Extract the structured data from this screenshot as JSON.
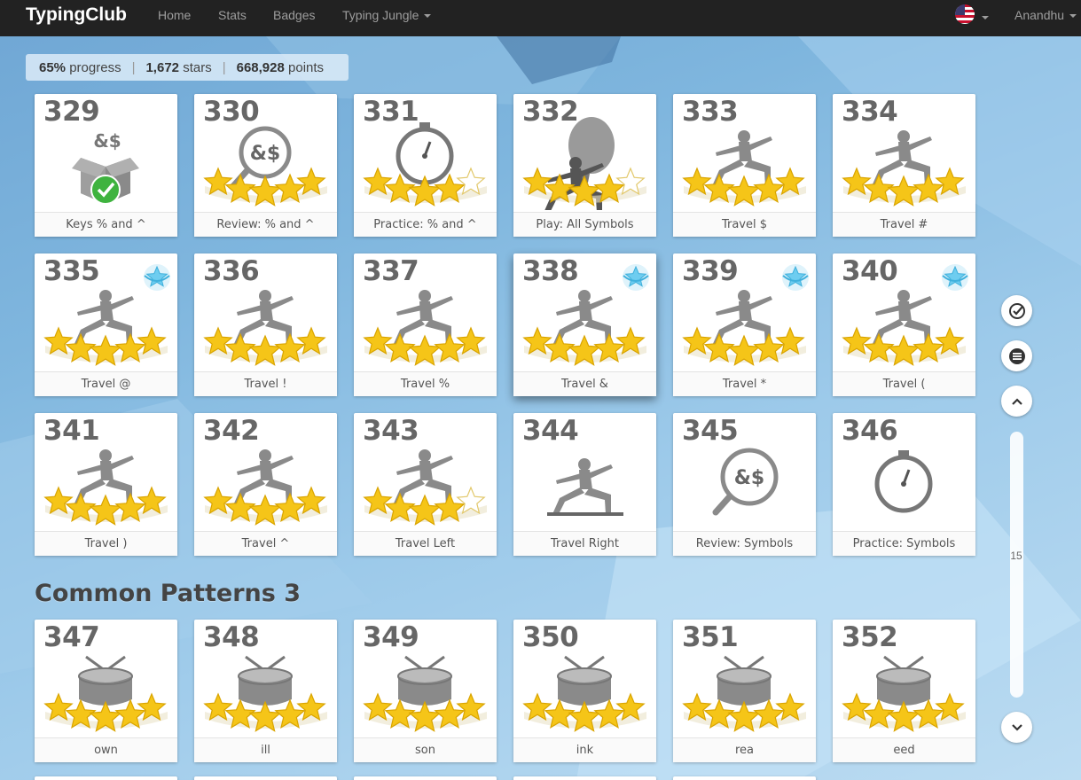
{
  "nav": {
    "brand": "TypingClub",
    "home": "Home",
    "stats": "Stats",
    "badges": "Badges",
    "jungle": "Typing Jungle",
    "user": "Anandhu"
  },
  "stats": {
    "progress_value": "65%",
    "progress_label": "progress",
    "stars_value": "1,672",
    "stars_label": "stars",
    "points_value": "668,928",
    "points_label": "points",
    "separator": "|"
  },
  "section": {
    "title": "Common Patterns 3"
  },
  "scroll": {
    "number": "15"
  },
  "colors": {
    "star": "#f5c518",
    "star_edge": "#d9a400",
    "figure": "#8a8a8a",
    "badge": "#6ecdf0",
    "check": "#3fb33f"
  },
  "lessons": [
    {
      "num": "329",
      "label": "Keys % and ^",
      "art": "box-check-icon",
      "stars": 0,
      "badge": false
    },
    {
      "num": "330",
      "label": "Review: % and ^",
      "art": "magnifier-icon",
      "stars": 5,
      "badge": false
    },
    {
      "num": "331",
      "label": "Practice: % and ^",
      "art": "stopwatch-icon",
      "stars": 4,
      "badge": false
    },
    {
      "num": "332",
      "label": "Play: All Symbols",
      "art": "balloon-icon",
      "stars": 4,
      "badge": false
    },
    {
      "num": "333",
      "label": "Travel $",
      "art": "lunge-figure-icon",
      "stars": 5,
      "badge": false
    },
    {
      "num": "334",
      "label": "Travel #",
      "art": "lunge-figure-icon",
      "stars": 5,
      "badge": false
    },
    {
      "num": "335",
      "label": "Travel @",
      "art": "lunge-figure-icon",
      "stars": 5,
      "badge": true
    },
    {
      "num": "336",
      "label": "Travel !",
      "art": "lunge-figure-icon",
      "stars": 5,
      "badge": false
    },
    {
      "num": "337",
      "label": "Travel %",
      "art": "lunge-figure-icon",
      "stars": 5,
      "badge": false
    },
    {
      "num": "338",
      "label": "Travel &",
      "art": "lunge-figure-icon",
      "stars": 5,
      "badge": true
    },
    {
      "num": "339",
      "label": "Travel *",
      "art": "lunge-figure-icon",
      "stars": 5,
      "badge": true
    },
    {
      "num": "340",
      "label": "Travel (",
      "art": "lunge-figure-icon",
      "stars": 5,
      "badge": true
    },
    {
      "num": "341",
      "label": "Travel )",
      "art": "lunge-figure-icon",
      "stars": 5,
      "badge": false
    },
    {
      "num": "342",
      "label": "Travel ^",
      "art": "lunge-figure-icon",
      "stars": 5,
      "badge": false
    },
    {
      "num": "343",
      "label": "Travel Left",
      "art": "lunge-figure-icon",
      "stars": 4,
      "badge": false
    },
    {
      "num": "344",
      "label": "Travel Right",
      "art": "lunge-figure-icon",
      "stars": 0,
      "badge": false
    },
    {
      "num": "345",
      "label": "Review: Symbols",
      "art": "magnifier-icon",
      "stars": 0,
      "badge": false
    },
    {
      "num": "346",
      "label": "Practice: Symbols",
      "art": "stopwatch-icon",
      "stars": 0,
      "badge": false
    },
    {
      "num": "347",
      "label": "own",
      "art": "drum-icon",
      "stars": 5,
      "badge": false
    },
    {
      "num": "348",
      "label": "ill",
      "art": "drum-icon",
      "stars": 5,
      "badge": false
    },
    {
      "num": "349",
      "label": "son",
      "art": "drum-icon",
      "stars": 5,
      "badge": false
    },
    {
      "num": "350",
      "label": "ink",
      "art": "drum-icon",
      "stars": 5,
      "badge": false
    },
    {
      "num": "351",
      "label": "rea",
      "art": "drum-icon",
      "stars": 5,
      "badge": false
    },
    {
      "num": "352",
      "label": "eed",
      "art": "drum-icon",
      "stars": 5,
      "badge": false
    }
  ]
}
